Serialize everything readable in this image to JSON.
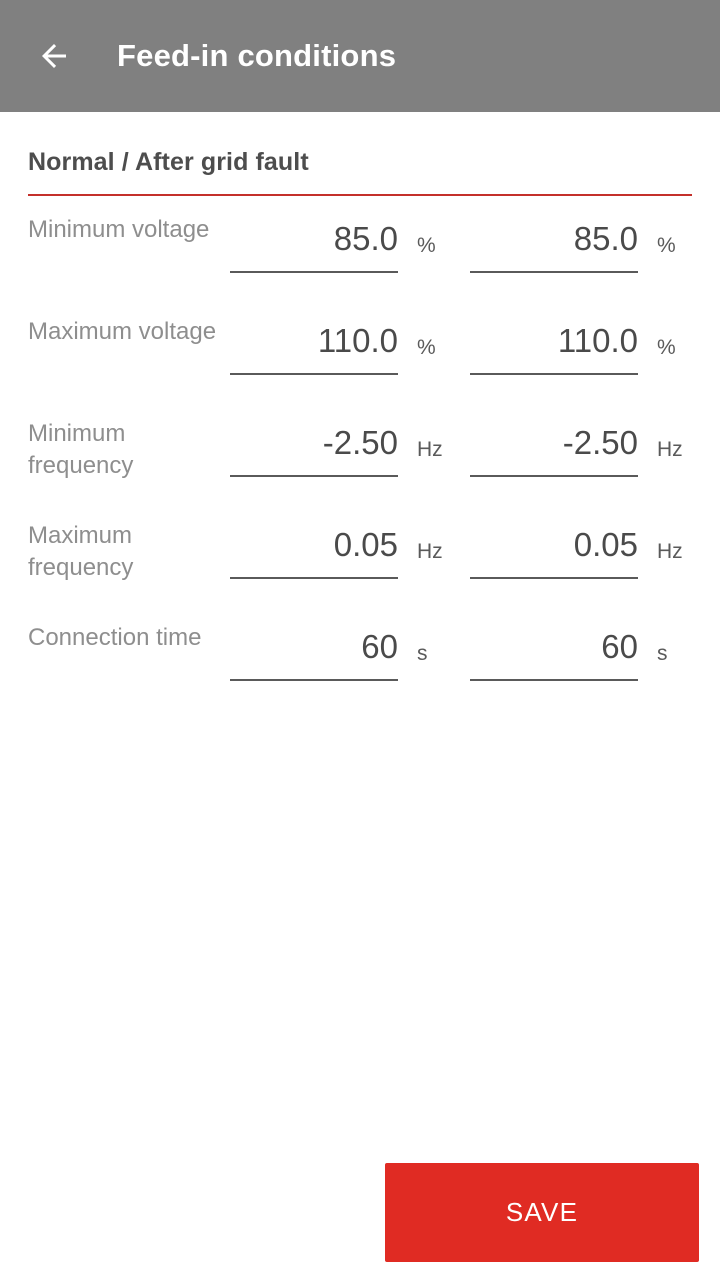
{
  "appbar": {
    "back_icon": "back-arrow-icon",
    "title": "Feed-in conditions"
  },
  "section": {
    "title": "Normal / After grid fault",
    "rule_color": "#c4302b"
  },
  "form": {
    "rows": [
      {
        "label": "Minimum voltage",
        "col1_value": "85.0",
        "col1_unit": "%",
        "col2_value": "85.0",
        "col2_unit": "%"
      },
      {
        "label": "Maximum voltage",
        "col1_value": "110.0",
        "col1_unit": "%",
        "col2_value": "110.0",
        "col2_unit": "%"
      },
      {
        "label": "Minimum frequency",
        "col1_value": "-2.50",
        "col1_unit": "Hz",
        "col2_value": "-2.50",
        "col2_unit": "Hz"
      },
      {
        "label": "Maximum frequency",
        "col1_value": "0.05",
        "col1_unit": "Hz",
        "col2_value": "0.05",
        "col2_unit": "Hz"
      },
      {
        "label": "Connection time",
        "col1_value": "60",
        "col1_unit": "s",
        "col2_value": "60",
        "col2_unit": "s"
      }
    ]
  },
  "footer": {
    "save_label": "SAVE",
    "save_color": "#e02b23"
  }
}
